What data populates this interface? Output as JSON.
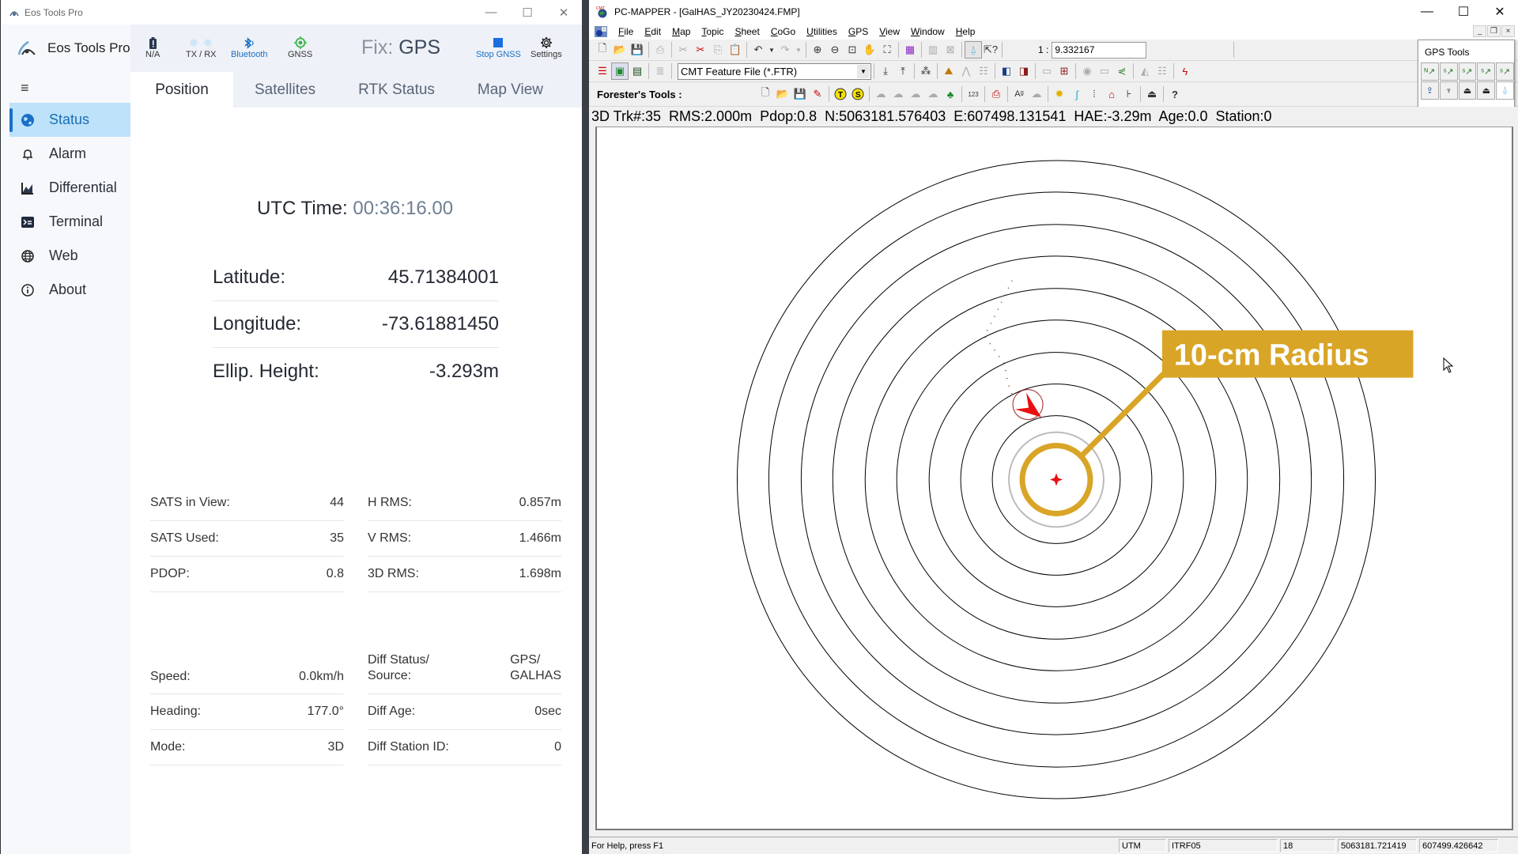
{
  "eos": {
    "window_title": "Eos Tools Pro",
    "brand_name": "Eos Tools Pro",
    "window_controls": {
      "minimize": "—",
      "maximize": "☐",
      "close": "✕"
    },
    "menu_icon": "hamburger-icon",
    "nav": [
      {
        "label": "Status",
        "icon": "globe-solid-icon",
        "active": true
      },
      {
        "label": "Alarm",
        "icon": "bell-icon",
        "active": false
      },
      {
        "label": "Differential",
        "icon": "chart-icon",
        "active": false
      },
      {
        "label": "Terminal",
        "icon": "terminal-icon",
        "active": false
      },
      {
        "label": "Web",
        "icon": "globe-icon",
        "active": false
      },
      {
        "label": "About",
        "icon": "info-icon",
        "active": false
      }
    ],
    "toolbar": {
      "battery_label": "N/A",
      "txrx_label": "TX / RX",
      "bluetooth_label": "Bluetooth",
      "gnss_label": "GNSS",
      "fix_label": "Fix:",
      "fix_value": "GPS",
      "stop_gnss_label": "Stop GNSS",
      "settings_label": "Settings"
    },
    "colors": {
      "accent": "#1a6fc7",
      "gnss_green": "#3cb44b",
      "active_nav_bg": "#bde2fa"
    },
    "tabs": [
      {
        "label": "Position",
        "active": true
      },
      {
        "label": "Satellites",
        "active": false
      },
      {
        "label": "RTK Status",
        "active": false
      },
      {
        "label": "Map View",
        "active": false
      }
    ],
    "position": {
      "utc_label": "UTC Time:",
      "utc_value": "00:36:16.00",
      "latitude_label": "Latitude:",
      "latitude_value": "45.71384001",
      "longitude_label": "Longitude:",
      "longitude_value": "-73.61881450",
      "height_label": "Ellip. Height:",
      "height_value": "-3.293m"
    },
    "stats_left_1": [
      {
        "label": "SATS in View:",
        "value": "44"
      },
      {
        "label": "SATS Used:",
        "value": "35"
      },
      {
        "label": "PDOP:",
        "value": "0.8"
      }
    ],
    "stats_right_1": [
      {
        "label": "H RMS:",
        "value": "0.857m"
      },
      {
        "label": "V RMS:",
        "value": "1.466m"
      },
      {
        "label": "3D RMS:",
        "value": "1.698m"
      }
    ],
    "stats_left_2": [
      {
        "label": "Speed:",
        "value": "0.0km/h"
      },
      {
        "label": "Heading:",
        "value": "177.0°"
      },
      {
        "label": "Mode:",
        "value": "3D"
      }
    ],
    "stats_right_2": [
      {
        "label_line1": "Diff Status/",
        "label_line2": "Source:",
        "value_line1": "GPS/",
        "value_line2": "GALHAS"
      },
      {
        "label": "Diff Age:",
        "value": "0sec"
      },
      {
        "label": "Diff Station ID:",
        "value": "0"
      }
    ]
  },
  "pcmapper": {
    "window_title": "PC-MAPPER - [GalHAS_JY20230424.FMP]",
    "window_controls": {
      "minimize": "—",
      "maximize": "☐",
      "close": "✕"
    },
    "mdi_controls": {
      "minimize": "_",
      "restore": "❐",
      "close": "×"
    },
    "menu": [
      {
        "label": "File",
        "accel": "F",
        "rest": "ile"
      },
      {
        "label": "Edit",
        "accel": "E",
        "rest": "dit"
      },
      {
        "label": "Map",
        "accel": "M",
        "rest": "ap"
      },
      {
        "label": "Topic",
        "accel": "T",
        "rest": "opic"
      },
      {
        "label": "Sheet",
        "accel": "S",
        "rest": "heet"
      },
      {
        "label": "CoGo",
        "accel": "C",
        "rest": "oGo"
      },
      {
        "label": "Utilities",
        "accel": "U",
        "rest": "tilities"
      },
      {
        "label": "GPS",
        "accel": "G",
        "rest": "PS"
      },
      {
        "label": "View",
        "accel": "V",
        "rest": "iew"
      },
      {
        "label": "Window",
        "accel": "W",
        "rest": "indow"
      },
      {
        "label": "Help",
        "accel": "H",
        "rest": "elp"
      }
    ],
    "scale_label": "1 :",
    "scale_value": "9.332167",
    "feature_file_combo": "CMT Feature File (*.FTR)",
    "foresters_tools_label": "Forester's Tools :",
    "gps_tools_title": "GPS Tools",
    "gps_info_line": "3D Trk#:35  RMS:2.000m  Pdop:0.8  N:5063181.576403  E:607498.131541  HAE:-3.29m  Age:0.0  Station:0",
    "callout_text": "10-cm Radius",
    "callout_color": "#d9a527",
    "status": {
      "help": "For Help, press F1",
      "projection": "UTM",
      "datum": "ITRF05",
      "zone": "18",
      "northing": "5063181.721419",
      "easting": "607499.426642"
    }
  }
}
